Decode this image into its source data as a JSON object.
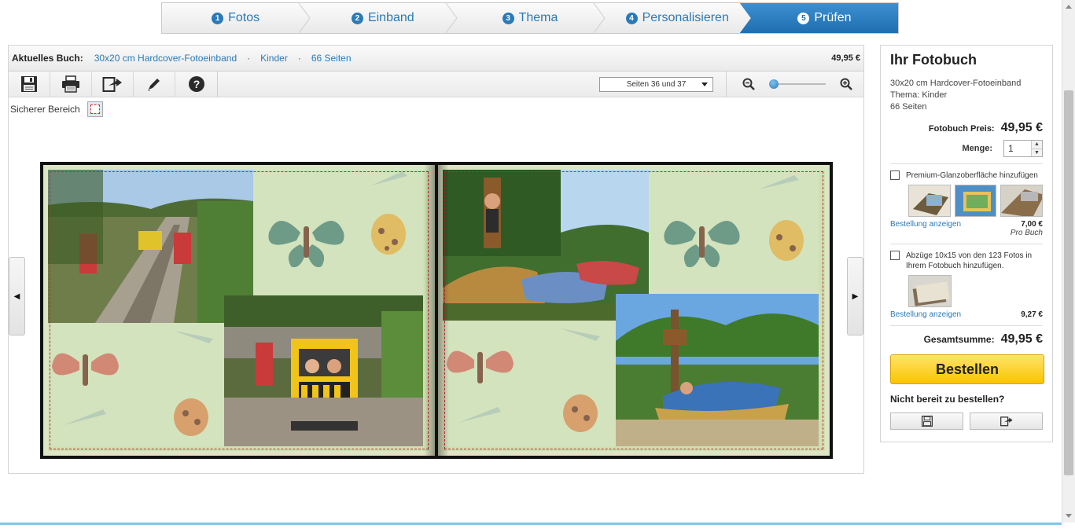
{
  "steps": [
    {
      "num": "1",
      "label": "Fotos"
    },
    {
      "num": "2",
      "label": "Einband"
    },
    {
      "num": "3",
      "label": "Thema"
    },
    {
      "num": "4",
      "label": "Personalisieren"
    },
    {
      "num": "5",
      "label": "Prüfen",
      "active": true
    }
  ],
  "infobar": {
    "label": "Aktuelles Buch:",
    "format": "30x20 cm Hardcover-Fotoeinband",
    "theme": "Kinder",
    "pages": "66 Seiten",
    "price": "49,95 €"
  },
  "toolbar": {
    "icons": [
      "save-icon",
      "print-icon",
      "share-icon",
      "edit-pencil-icon",
      "help-icon"
    ],
    "help_glyph": "?",
    "pages_select": "Seiten 36 und 37",
    "zoom_level": 0.05
  },
  "safe_area": {
    "label": "Sicherer Bereich"
  },
  "nav": {
    "prev_glyph": "◀",
    "next_glyph": "▶"
  },
  "side": {
    "title": "Ihr Fotobuch",
    "line1": "30x20 cm Hardcover-Fotoeinband",
    "line2": "Thema: Kinder",
    "line3": "66 Seiten",
    "price_label": "Fotobuch Preis:",
    "price_value": "49,95 €",
    "qty_label": "Menge:",
    "qty_value": "1",
    "option1": {
      "label": "Premium-Glanzoberfläche hinzufügen",
      "link": "Bestellung anzeigen",
      "price": "7,00 €",
      "unit": "Pro Buch"
    },
    "option2": {
      "label": "Abzüge 10x15 von den 123 Fotos in Ihrem Fotobuch hinzufügen.",
      "link": "Bestellung anzeigen",
      "price": "9,27 €"
    },
    "total_label": "Gesamtsumme:",
    "total_value": "49,95 €",
    "order_button": "Bestellen",
    "not_ready": "Nicht bereit zu bestellen?"
  },
  "colors": {
    "accent": "#2a7ab8",
    "order": "#f9c400",
    "safe_line": "#c1272d",
    "page_bg": "#d3e3bd"
  }
}
